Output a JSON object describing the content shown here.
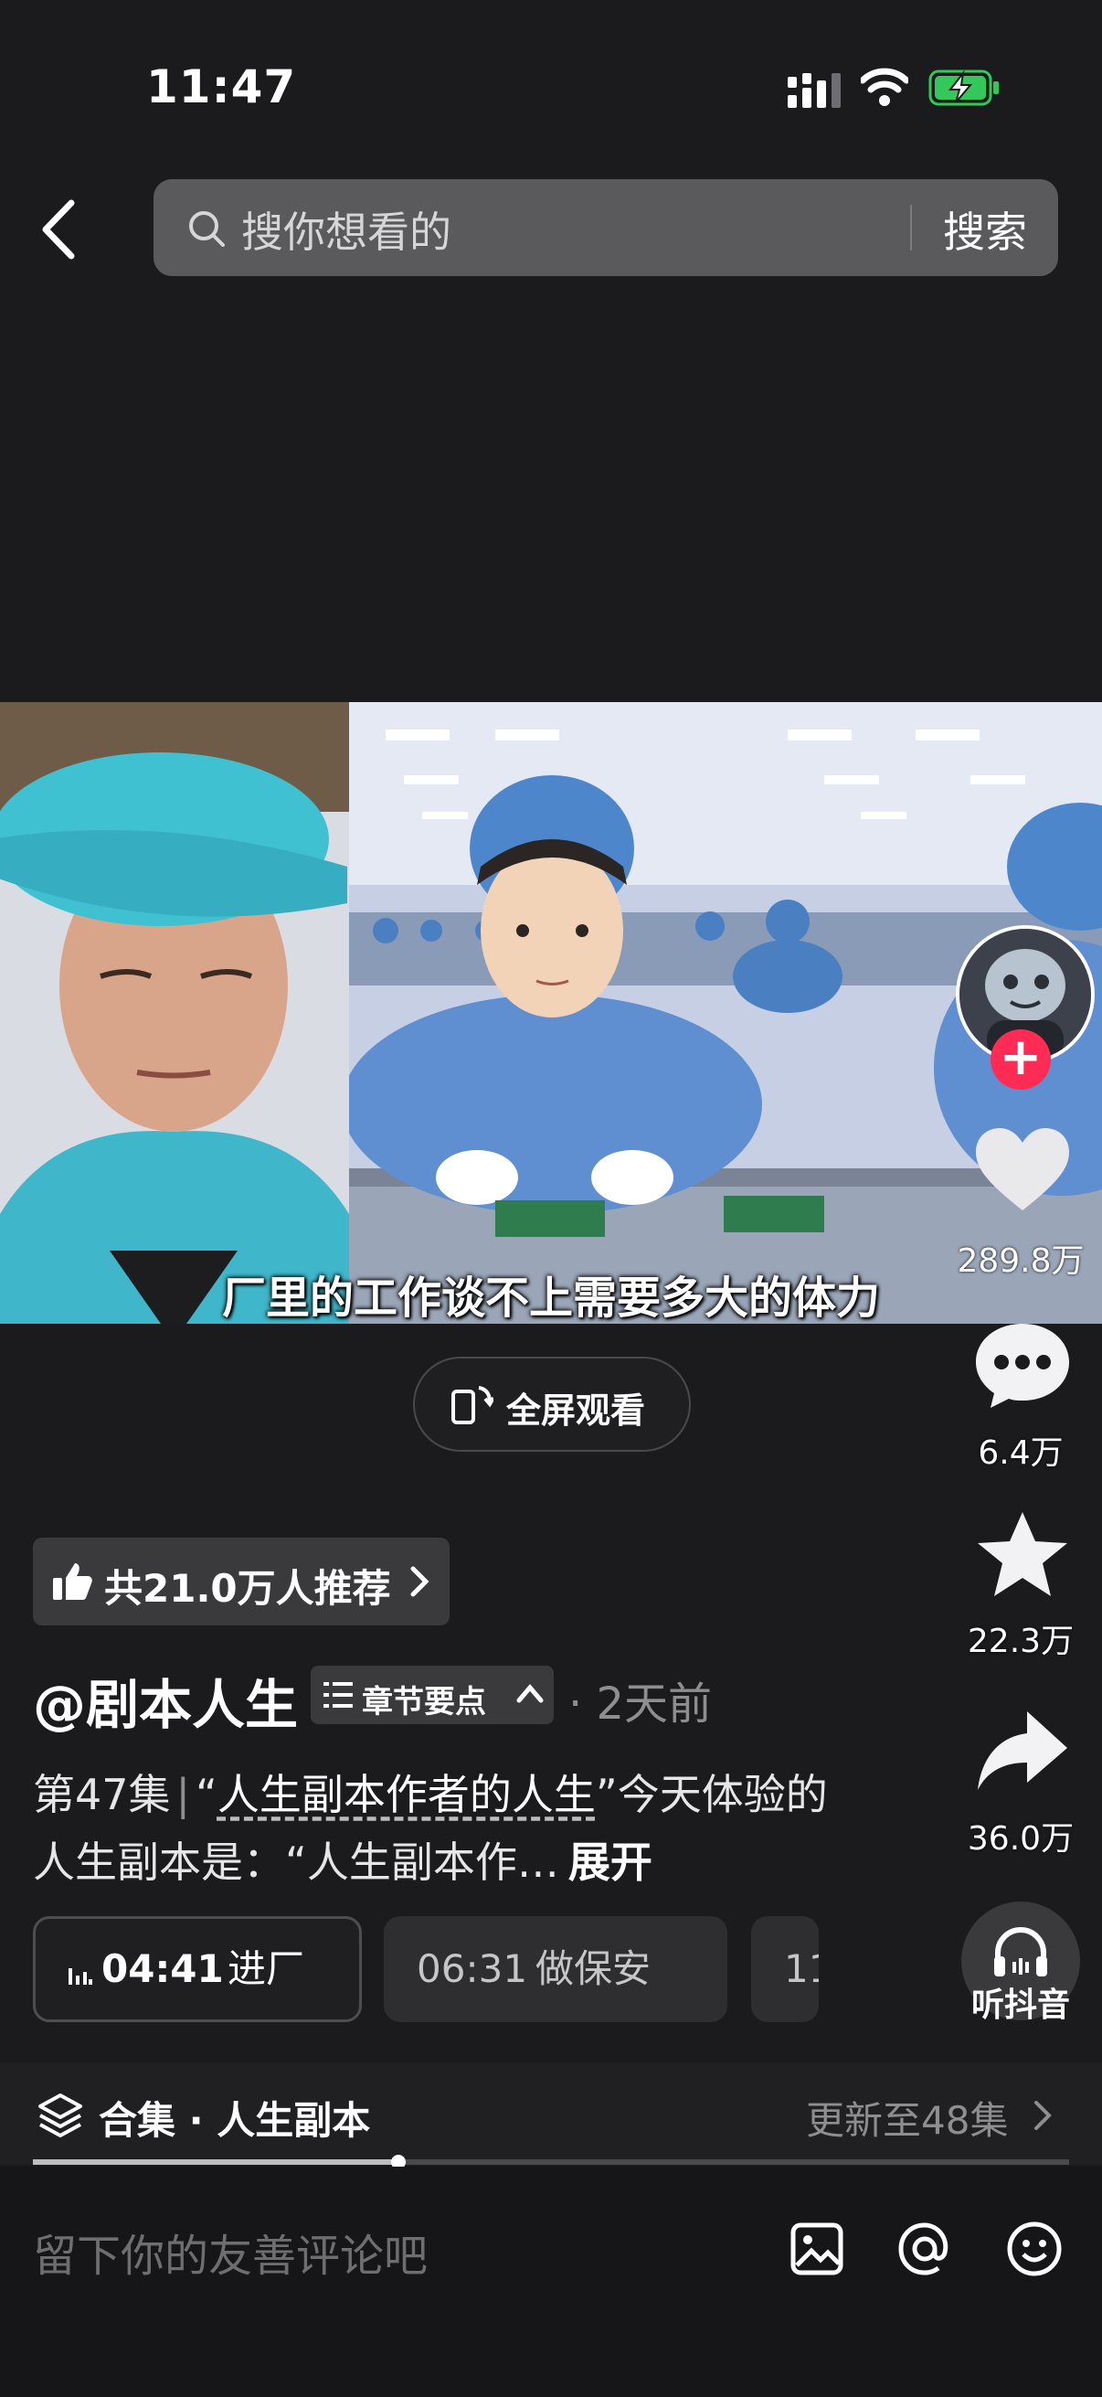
{
  "status_bar": {
    "time": "11:47"
  },
  "search": {
    "placeholder": "搜你想看的",
    "button": "搜索"
  },
  "video": {
    "subtitle": "厂里的工作谈不上需要多大的体力"
  },
  "fullscreen": {
    "label": "全屏观看"
  },
  "rail": {
    "likes": "289.8万",
    "comments": "6.4万",
    "favorites": "22.3万",
    "shares": "36.0万",
    "listen": "听抖音"
  },
  "recommend": {
    "label": "共21.0万人推荐"
  },
  "author": {
    "name": "@剧本人生",
    "chapter_label": "章节要点",
    "time_ago": "· 2天前"
  },
  "description": {
    "episode": "第47集",
    "separator": "|",
    "title_quoted": "人生副本作者的人生",
    "rest": "今天体验的人生副本是：“人生副本作…",
    "expand": "展开"
  },
  "chapters": [
    {
      "time": "04:41",
      "label": "进厂"
    },
    {
      "time": "06:31",
      "label": "做保安"
    },
    {
      "time": "11",
      "label": ""
    }
  ],
  "collection": {
    "title": "合集 · 人生副本",
    "update": "更新至48集"
  },
  "comment": {
    "placeholder": "留下你的友善评论吧"
  },
  "colors": {
    "accent": "#fe2c55",
    "background": "#1b1b1d"
  }
}
